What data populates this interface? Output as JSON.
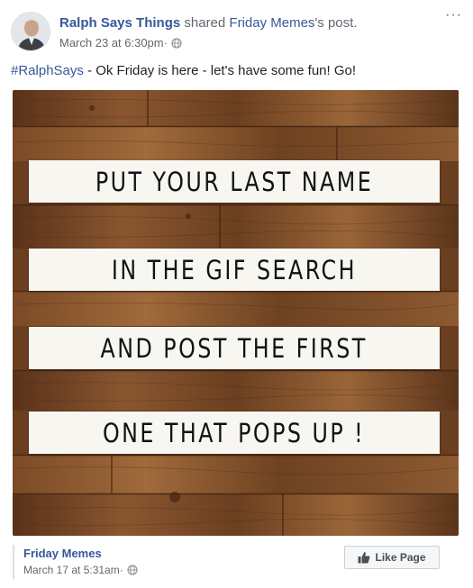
{
  "post": {
    "author": "Ralph Says Things",
    "action": " shared ",
    "shared_page": "Friday Memes",
    "shared_suffix": "'s post.",
    "timestamp": "March 23 at 6:30pm",
    "dot": " · ",
    "hashtag": "#RalphSays",
    "text": " - Ok Friday is here - let's have some fun! Go!",
    "more_label": "···"
  },
  "meme": {
    "lines": [
      "PUT YOUR LAST NAME",
      "IN THE GIF SEARCH",
      "AND POST THE FIRST",
      "ONE THAT POPS UP !"
    ]
  },
  "shared_from": {
    "page_name": "Friday Memes",
    "timestamp": "March 17 at 5:31am",
    "dot": " · ",
    "like_button": "Like Page"
  },
  "icons": {
    "avatar": "profile-photo",
    "privacy": "globe-icon",
    "like": "thumbs-up-icon",
    "more": "more-options-icon"
  },
  "colors": {
    "link": "#365899",
    "meta": "#616770",
    "wood": "#7a4a26"
  }
}
